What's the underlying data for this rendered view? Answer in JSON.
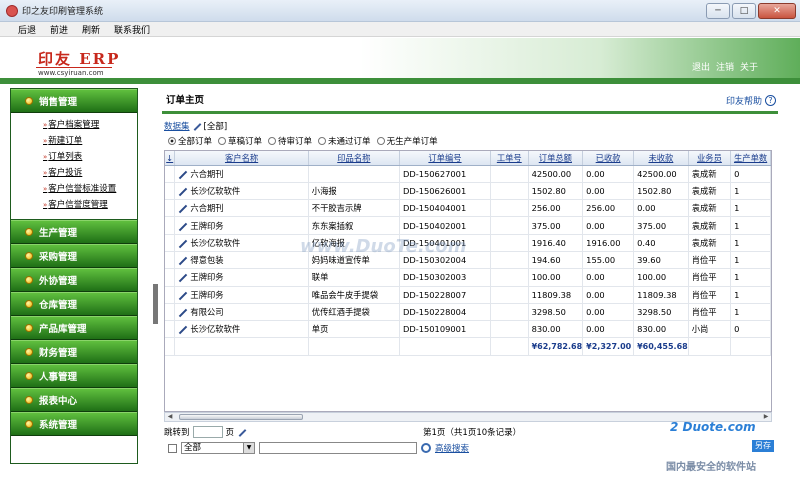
{
  "window": {
    "title": "印之友印刷管理系统",
    "min": "─",
    "max": "□",
    "close": "✕"
  },
  "menu": [
    "后退",
    "前进",
    "刷新",
    "联系我们"
  ],
  "header": {
    "logo": "印友 ERP",
    "url": "www.csyiruan.com",
    "links": [
      "退出",
      "注销",
      "关于"
    ]
  },
  "sidebar": {
    "active": "销售管理",
    "subitems": [
      "客户档案管理",
      "新建订单",
      "订单列表",
      "客户投诉",
      "客户信誉标准设置",
      "客户信誉度管理"
    ],
    "sections": [
      "生产管理",
      "采购管理",
      "外协管理",
      "仓库管理",
      "产品库管理",
      "财务管理",
      "人事管理",
      "报表中心",
      "系统管理"
    ]
  },
  "main": {
    "title": "订单主页",
    "help": "印友帮助",
    "dataset_label": "数据集",
    "dataset_value": "[全部]",
    "filters": [
      {
        "label": "全部订单",
        "checked": true
      },
      {
        "label": "草稿订单",
        "checked": false
      },
      {
        "label": "待审订单",
        "checked": false
      },
      {
        "label": "未通过订单",
        "checked": false
      },
      {
        "label": "无生产单订单",
        "checked": false
      }
    ],
    "sort_icon": "↓",
    "columns": [
      "客户名称",
      "印品名称",
      "订单编号",
      "工单号",
      "订单总额",
      "已收款",
      "未收款",
      "业务员",
      "生产单数"
    ],
    "rows": [
      [
        "六合期刊",
        "",
        "DD-150627001",
        "",
        "42500.00",
        "0.00",
        "42500.00",
        "袁成新",
        "0"
      ],
      [
        "长沙亿软软件",
        "小海报",
        "DD-150626001",
        "",
        "1502.80",
        "0.00",
        "1502.80",
        "袁成新",
        "1"
      ],
      [
        "六合期刊",
        "不干胶吉示牌",
        "DD-150404001",
        "",
        "256.00",
        "256.00",
        "0.00",
        "袁成新",
        "1"
      ],
      [
        "王牌印务",
        "东东案插叙",
        "DD-150402001",
        "",
        "375.00",
        "0.00",
        "375.00",
        "袁成新",
        "1"
      ],
      [
        "长沙亿软软件",
        "亿软海报",
        "DD-150401001",
        "",
        "1916.40",
        "1916.00",
        "0.40",
        "袁成新",
        "1"
      ],
      [
        "得意包装",
        "妈妈味道宣传单",
        "DD-150302004",
        "",
        "194.60",
        "155.00",
        "39.60",
        "肖俭平",
        "1"
      ],
      [
        "王牌印务",
        "联单",
        "DD-150302003",
        "",
        "100.00",
        "0.00",
        "100.00",
        "肖俭平",
        "1"
      ],
      [
        "王牌印务",
        "唯品会牛皮手提袋",
        "DD-150228007",
        "",
        "11809.38",
        "0.00",
        "11809.38",
        "肖俭平",
        "1"
      ],
      [
        "有限公司",
        "优传红酒手提袋",
        "DD-150228004",
        "",
        "3298.50",
        "0.00",
        "3298.50",
        "肖俭平",
        "1"
      ],
      [
        "长沙亿软软件",
        "单页",
        "DD-150109001",
        "",
        "830.00",
        "0.00",
        "830.00",
        "小尚",
        "0"
      ]
    ],
    "totals": {
      "total": "¥62,782.68",
      "paid": "¥2,327.00",
      "unpaid": "¥60,455.68"
    },
    "pager": {
      "jump_label": "跳转到",
      "page_suffix": "页",
      "info": "第1页（共1页10条记录）"
    },
    "search": {
      "select_value": "全部",
      "advanced": "高级搜索"
    }
  },
  "watermark": {
    "logo": "2 Duote.com",
    "tag": "另存",
    "text": "国内最安全的软件站",
    "mid": "www.DuoTe.com"
  }
}
